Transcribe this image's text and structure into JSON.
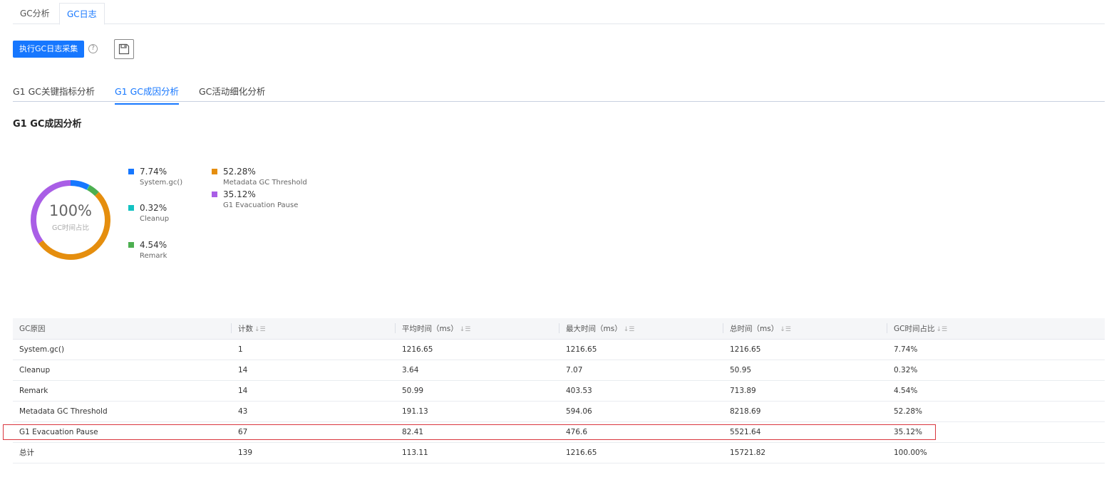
{
  "top_tabs": [
    {
      "label": "GC分析"
    },
    {
      "label": "GC日志"
    }
  ],
  "toolbar": {
    "collect_label": "执行GC日志采集",
    "help_glyph": "?"
  },
  "sub_tabs": [
    {
      "label": "G1 GC关键指标分析"
    },
    {
      "label": "G1 GC成因分析"
    },
    {
      "label": "GC活动细化分析"
    }
  ],
  "section_title": "G1 GC成因分析",
  "chart_data": {
    "type": "pie",
    "center_value": "100%",
    "center_label": "GC时间占比",
    "slices": [
      {
        "name": "System.gc()",
        "label": "7.74%",
        "value": 7.74,
        "color": "#1677ff"
      },
      {
        "name": "Cleanup",
        "label": "0.32%",
        "value": 0.32,
        "color": "#13c2c2"
      },
      {
        "name": "Remark",
        "label": "4.54%",
        "value": 4.54,
        "color": "#4caf50"
      },
      {
        "name": "Metadata GC Threshold",
        "label": "52.28%",
        "value": 52.28,
        "color": "#e58e0e"
      },
      {
        "name": "G1 Evacuation Pause",
        "label": "35.12%",
        "value": 35.12,
        "color": "#a95ee6"
      }
    ]
  },
  "table": {
    "sort_glyph": "↓☰",
    "headers": [
      "GC原因",
      "计数",
      "平均时间（ms）",
      "最大时间（ms）",
      "总时间（ms）",
      "GC时间占比"
    ],
    "rows": [
      [
        "System.gc()",
        "1",
        "1216.65",
        "1216.65",
        "1216.65",
        "7.74%"
      ],
      [
        "Cleanup",
        "14",
        "3.64",
        "7.07",
        "50.95",
        "0.32%"
      ],
      [
        "Remark",
        "14",
        "50.99",
        "403.53",
        "713.89",
        "4.54%"
      ],
      [
        "Metadata GC Threshold",
        "43",
        "191.13",
        "594.06",
        "8218.69",
        "52.28%"
      ],
      [
        "G1 Evacuation Pause",
        "67",
        "82.41",
        "476.6",
        "5521.64",
        "35.12%"
      ],
      [
        "总计",
        "139",
        "113.11",
        "1216.65",
        "15721.82",
        "100.00%"
      ]
    ]
  }
}
